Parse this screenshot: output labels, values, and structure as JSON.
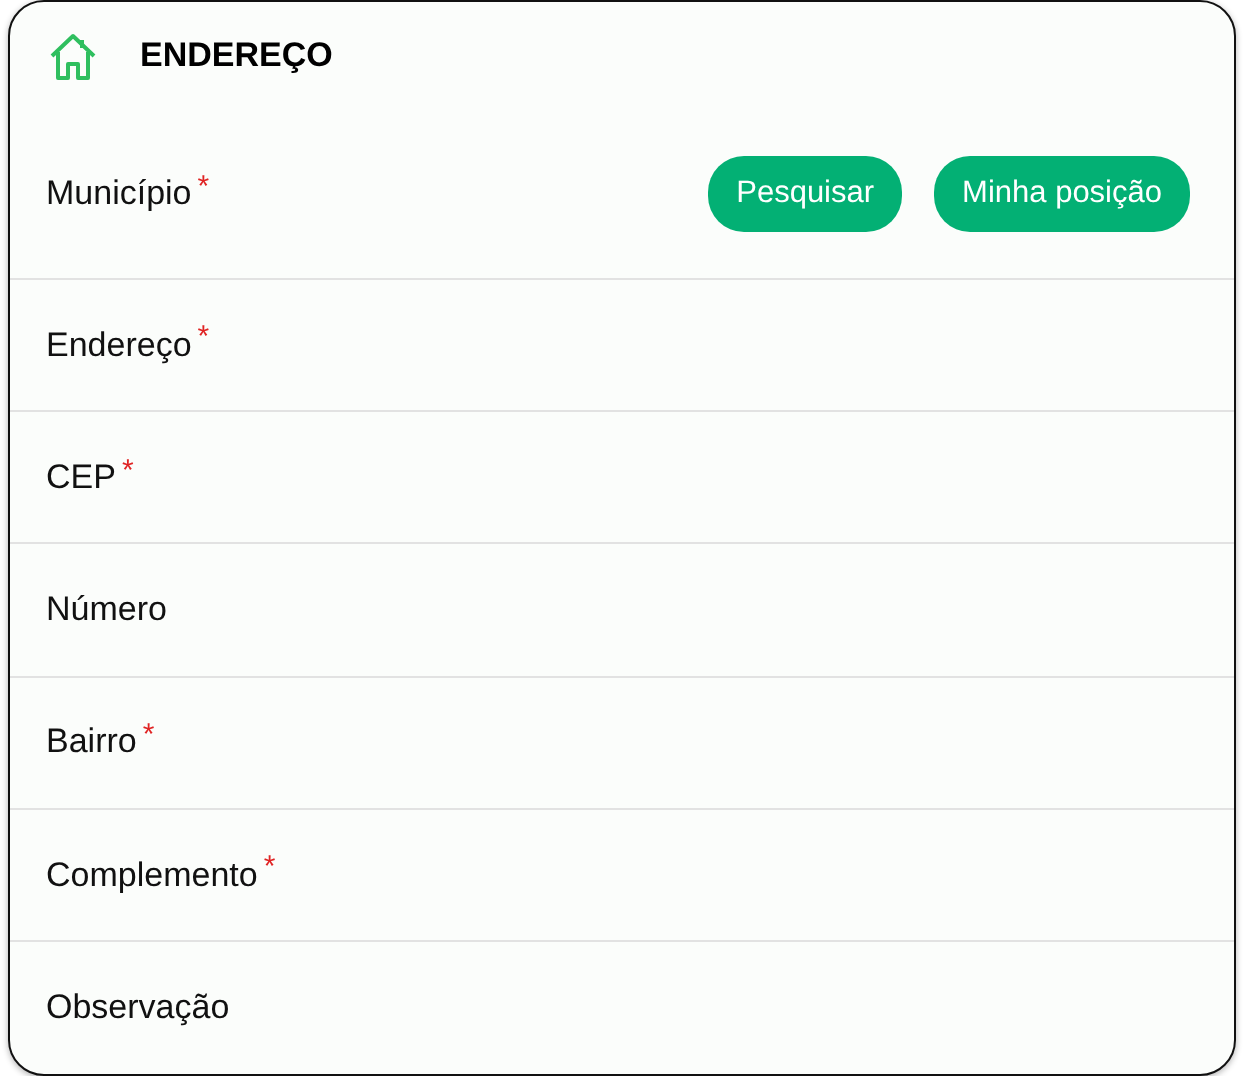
{
  "header": {
    "title": "ENDEREÇO"
  },
  "required_mark": "*",
  "fields": [
    {
      "label": "Município",
      "required": true,
      "buttons": [
        "Pesquisar",
        "Minha posição"
      ]
    },
    {
      "label": "Endereço",
      "required": true
    },
    {
      "label": "CEP",
      "required": true
    },
    {
      "label": "Número",
      "required": false
    },
    {
      "label": "Bairro",
      "required": true
    },
    {
      "label": "Complemento",
      "required": true
    },
    {
      "label": "Observação",
      "required": false
    }
  ]
}
